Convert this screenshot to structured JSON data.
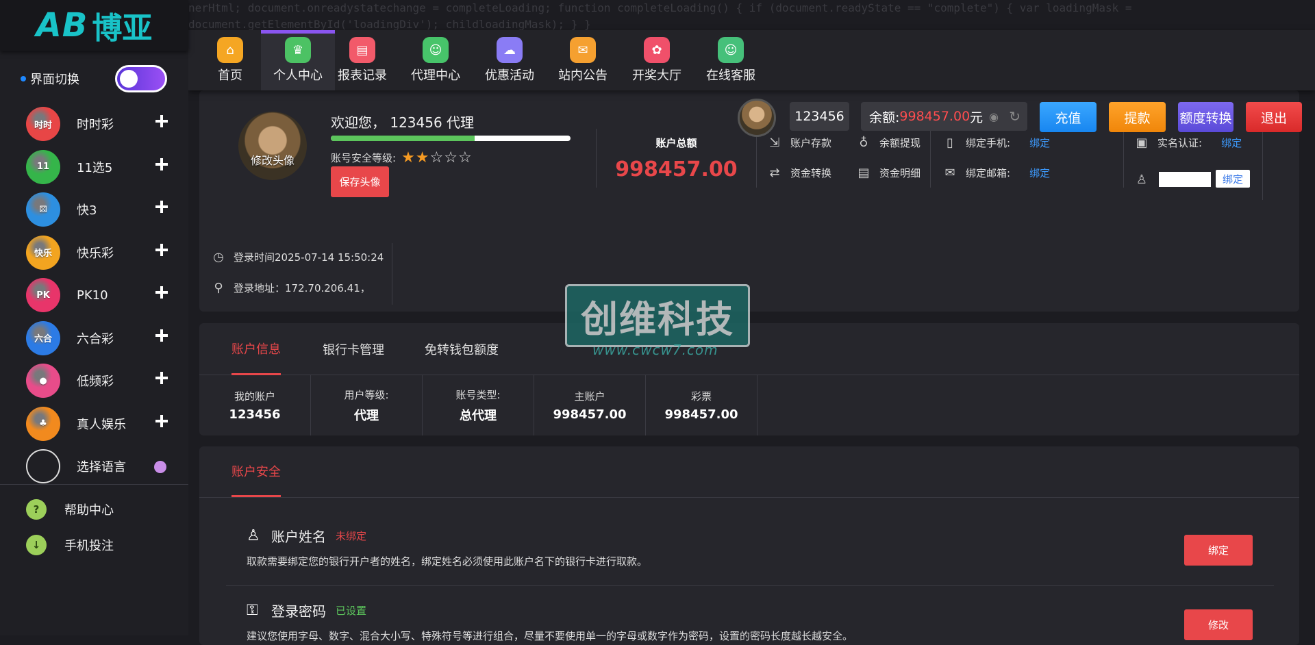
{
  "code_leak": "nerHtml; document.onreadystatechange = completeLoading; function completeLoading() { if (document.readyState == \"complete\") { var loadingMask = document.getElementById('loadingDiv'); childloadingMask); } }",
  "logo": {
    "mark": "AB",
    "text": "博亚"
  },
  "theme": {
    "label": "界面切换"
  },
  "sidebar": {
    "games": [
      {
        "label": "时时彩",
        "icon": "shishicai-icon",
        "icon_text": "时时",
        "color": "#e84646"
      },
      {
        "label": "11选5",
        "icon": "11x5-icon",
        "icon_text": "11",
        "color": "#35b54a"
      },
      {
        "label": "快3",
        "icon": "dice-icon",
        "icon_text": "⚄",
        "color": "#2d8fe0"
      },
      {
        "label": "快乐彩",
        "icon": "happy-lottery-icon",
        "icon_text": "快乐",
        "color": "#f2a420"
      },
      {
        "label": "PK10",
        "icon": "pk10-icon",
        "icon_text": "PK",
        "color": "#e8356a"
      },
      {
        "label": "六合彩",
        "icon": "liuhecai-icon",
        "icon_text": "六合",
        "color": "#2c7be5"
      },
      {
        "label": "低频彩",
        "icon": "lowfreq-icon",
        "icon_text": "●",
        "color": "#e84c8a"
      },
      {
        "label": "真人娱乐",
        "icon": "live-casino-icon",
        "icon_text": "♣",
        "color": "#f28a1e"
      },
      {
        "label": "选择语言",
        "icon": "language-icon",
        "icon_text": "",
        "color": "#cccccc"
      }
    ],
    "help": "帮助中心",
    "mobile": "手机投注"
  },
  "nav": [
    {
      "label": "首页",
      "icon": "home-icon",
      "glyph": "⌂",
      "color": "#f5a623"
    },
    {
      "label": "个人中心",
      "icon": "crown-icon",
      "glyph": "♛",
      "color": "#4cc264",
      "active": true
    },
    {
      "label": "报表记录",
      "icon": "report-icon",
      "glyph": "▤",
      "color": "#f25a6a"
    },
    {
      "label": "代理中心",
      "icon": "agent-icon",
      "glyph": "☺",
      "color": "#47c46a"
    },
    {
      "label": "优惠活动",
      "icon": "promo-icon",
      "glyph": "☁",
      "color": "#8a7cf5"
    },
    {
      "label": "站内公告",
      "icon": "notice-icon",
      "glyph": "✉",
      "color": "#f5a030"
    },
    {
      "label": "开奖大厅",
      "icon": "draw-hall-icon",
      "glyph": "✿",
      "color": "#f0506a"
    },
    {
      "label": "在线客服",
      "icon": "service-icon",
      "glyph": "☺",
      "color": "#46c07a"
    }
  ],
  "header": {
    "username": "123456",
    "balance_label": "余额:",
    "balance": "998457.00",
    "balance_unit": "元",
    "recharge": "充值",
    "withdraw": "提款",
    "transfer": "额度转换",
    "logout": "退出"
  },
  "profile": {
    "avatar_label": "修改头像",
    "welcome": "欢迎您， 123456 代理",
    "progress": 0.6,
    "security_label": "账号安全等级:",
    "stars_on": 2,
    "stars_total": 5,
    "save_avatar": "保存头像",
    "total_label": "账户总额",
    "total_value": "998457.00",
    "ops": {
      "deposit": "账户存款",
      "withdraw_balance": "余额提现",
      "fund_transfer": "资金转换",
      "fund_detail": "资金明细",
      "phone": "绑定手机:",
      "email": "绑定邮箱:",
      "realname": "实名认证:",
      "bind": "绑定"
    },
    "login_time": "登录时间2025-07-14 15:50:24",
    "login_addr": "登录地址：172.70.206.41，"
  },
  "watermark": {
    "text": "创维科技",
    "url": "www.cwcw7.com"
  },
  "tabs": [
    "账户信息",
    "银行卡管理",
    "免转钱包额度"
  ],
  "account_info": [
    {
      "k": "我的账户",
      "v": "123456"
    },
    {
      "k": "用户等级:",
      "v": "代理"
    },
    {
      "k": "账号类型:",
      "v": "总代理"
    },
    {
      "k": "主账户",
      "v": "998457.00"
    },
    {
      "k": "彩票",
      "v": "998457.00"
    }
  ],
  "security": {
    "tab": "账户安全",
    "items": [
      {
        "title": "账户姓名",
        "status": "未绑定",
        "desc": "取款需要绑定您的银行开户者的姓名，绑定姓名必须使用此账户名下的银行卡进行取款。",
        "button": "绑定"
      },
      {
        "title": "登录密码",
        "status": "已设置",
        "desc": "建议您使用字母、数字、混合大小写、特殊符号等进行组合，尽量不要使用单一的字母或数字作为密码，设置的密码长度越长越安全。",
        "button": "修改"
      }
    ]
  }
}
